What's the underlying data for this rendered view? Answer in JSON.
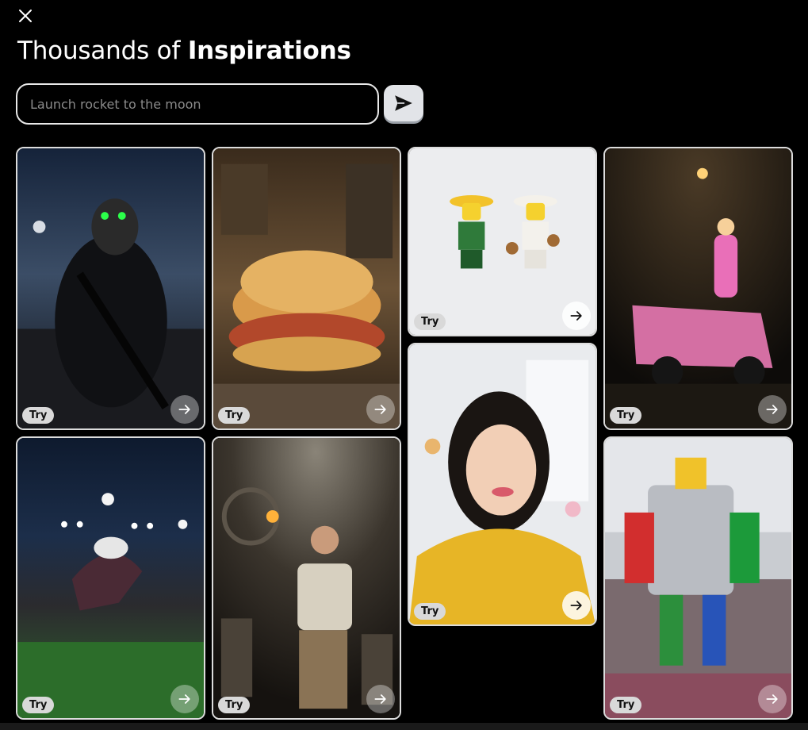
{
  "header": {
    "close_icon": "close-icon",
    "title_regular": "Thousands of ",
    "title_bold": "Inspirations"
  },
  "search": {
    "placeholder": "Launch rocket to the moon",
    "value": "",
    "send_icon": "send-icon"
  },
  "cards": [
    {
      "id": "walrus-soldier",
      "try_label": "Try",
      "icon": "arrow-right-icon"
    },
    {
      "id": "lego-burger-factory",
      "try_label": "Try",
      "icon": "arrow-right-icon"
    },
    {
      "id": "lego-mariachi",
      "try_label": "Try",
      "icon": "arrow-right-icon"
    },
    {
      "id": "princess-kart",
      "try_label": "Try",
      "icon": "arrow-right-icon"
    },
    {
      "id": "woman-portrait",
      "try_label": "Try",
      "icon": "arrow-right-icon"
    },
    {
      "id": "stadium-wizard",
      "try_label": "Try",
      "icon": "arrow-right-icon"
    },
    {
      "id": "explorer-torch",
      "try_label": "Try",
      "icon": "arrow-right-icon"
    },
    {
      "id": "robot-store",
      "try_label": "Try",
      "icon": "arrow-right-icon"
    }
  ],
  "colors": {
    "background": "#000000",
    "border": "#dcdcdc",
    "badge": "#d9d9d9",
    "send_button": "#e2e4e8"
  }
}
